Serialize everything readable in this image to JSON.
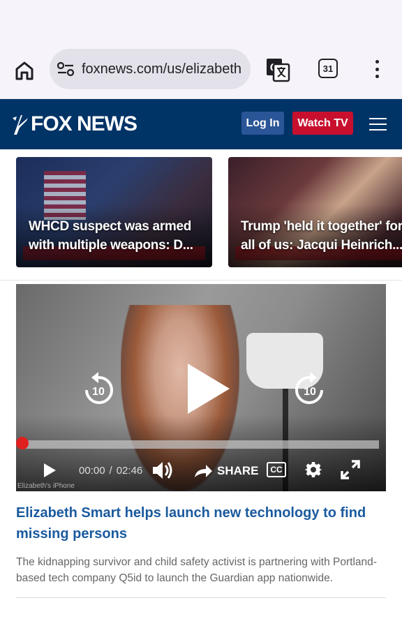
{
  "browser": {
    "url": "foxnews.com/us/elizabeth",
    "tab_count": "31"
  },
  "header": {
    "logo_text": "FOX NEWS",
    "login_label": "Log In",
    "watch_label": "Watch TV",
    "colors": {
      "header_bg": "#003366",
      "login_bg": "#2a5597",
      "watch_bg": "#c8102e"
    }
  },
  "cards": [
    {
      "headline_line1": "WHCD suspect was armed",
      "headline_line2": "with multiple weapons: D..."
    },
    {
      "headline_line1": "Trump 'held it together' for",
      "headline_line2": "all of us: Jacqui Heinrich..."
    }
  ],
  "video": {
    "current_time": "00:00",
    "separator": "/",
    "duration": "02:46",
    "share_label": "SHARE",
    "cc_label": "CC",
    "rewind_seconds": "10",
    "forward_seconds": "10",
    "progress": 0,
    "watermark": "Elizabeth's iPhone"
  },
  "article": {
    "title": "Elizabeth Smart helps launch new technology to find missing persons",
    "description": "The kidnapping survivor and child safety activist is partnering with Portland-based tech company Q5id to launch the Guardian app nationwide.",
    "title_color": "#1a5a9e"
  }
}
